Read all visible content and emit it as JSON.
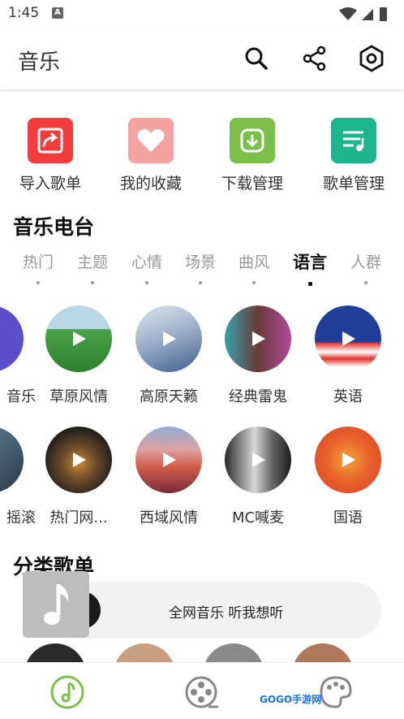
{
  "status_bar": {
    "time": "1:45",
    "notification_glyph": "A"
  },
  "app_bar": {
    "title": "音乐",
    "icons": [
      "search-icon",
      "share-icon",
      "settings-hex-icon"
    ]
  },
  "shortcuts": [
    {
      "label": "导入歌单",
      "color": "#f23d3d",
      "icon": "import-playlist-icon"
    },
    {
      "label": "我的收藏",
      "color": "#f4a3a3",
      "icon": "heart-icon"
    },
    {
      "label": "下载管理",
      "color": "#7cc04b",
      "icon": "download-icon"
    },
    {
      "label": "歌单管理",
      "color": "#1db58f",
      "icon": "playlist-manage-icon"
    }
  ],
  "radio": {
    "title": "音乐电台",
    "tabs": [
      {
        "label": "热门",
        "active": false
      },
      {
        "label": "主题",
        "active": false
      },
      {
        "label": "心情",
        "active": false
      },
      {
        "label": "场景",
        "active": false
      },
      {
        "label": "曲风",
        "active": false
      },
      {
        "label": "语言",
        "active": true
      },
      {
        "label": "人群",
        "active": false
      }
    ],
    "row1": [
      {
        "label": "音乐",
        "cover": "#5a4fc9"
      },
      {
        "label": "草原风情",
        "cover": "#3e9a3b"
      },
      {
        "label": "高原天籁",
        "cover": "#6f8fb8"
      },
      {
        "label": "经典雷鬼",
        "cover": "#8a4a6a"
      },
      {
        "label": "英语",
        "cover": "#1f3f9a"
      }
    ],
    "row2": [
      {
        "label": "摇滚",
        "cover": "#4a5a6a"
      },
      {
        "label": "热门网...",
        "cover": "#2e2a2a"
      },
      {
        "label": "西域风情",
        "cover": "#c0504a"
      },
      {
        "label": "MC喊麦",
        "cover": "#555555"
      },
      {
        "label": "国语",
        "cover": "#e04a2a"
      }
    ]
  },
  "category": {
    "title": "分类歌单"
  },
  "mini_player": {
    "text": "全网音乐 听我想听"
  },
  "bottom_nav": [
    {
      "name": "music",
      "icon": "music-note-icon",
      "active": true
    },
    {
      "name": "video",
      "icon": "film-reel-icon",
      "active": false
    },
    {
      "name": "skin",
      "icon": "palette-icon",
      "active": false
    }
  ],
  "watermark": "GOGO手游网",
  "colors": {
    "accent": "#7cc04b"
  }
}
